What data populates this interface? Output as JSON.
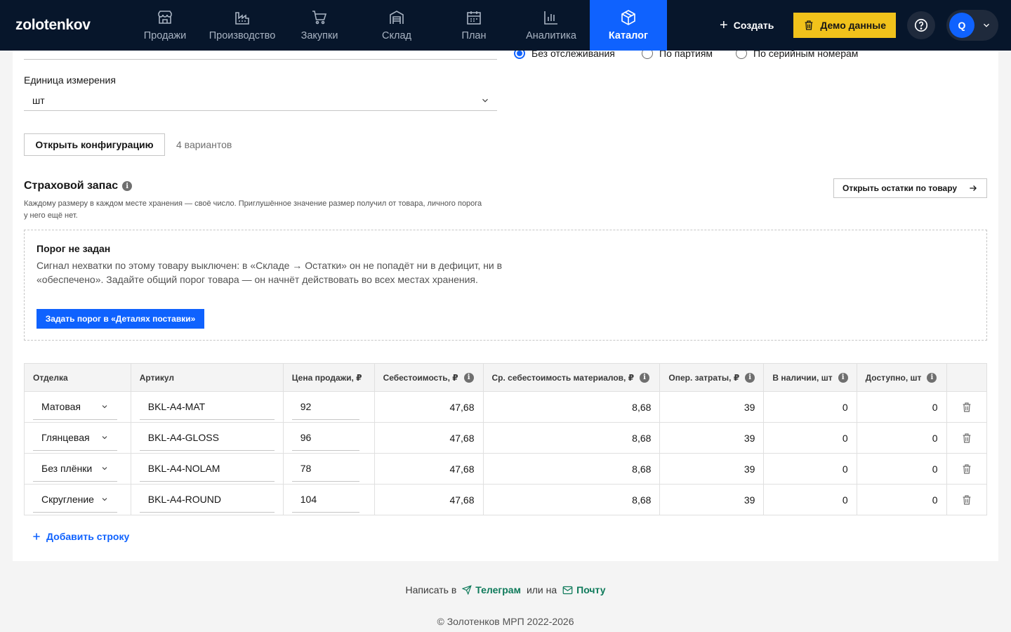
{
  "nav": {
    "logo": "zolotenkov",
    "items": [
      {
        "label": "Продажи",
        "icon": "store-icon"
      },
      {
        "label": "Производство",
        "icon": "factory-icon"
      },
      {
        "label": "Закупки",
        "icon": "cart-icon"
      },
      {
        "label": "Склад",
        "icon": "warehouse-icon"
      },
      {
        "label": "План",
        "icon": "calendar-icon"
      },
      {
        "label": "Аналитика",
        "icon": "bar-chart-icon"
      },
      {
        "label": "Каталог",
        "icon": "package-icon",
        "active": true
      }
    ],
    "create_label": "Создать",
    "demo_label": "Демо данные",
    "user_initial": "Q"
  },
  "form": {
    "unit_label": "Единица измерения",
    "unit_value": "шт",
    "tracking_options": [
      {
        "label": "Без отслеживания",
        "selected": true
      },
      {
        "label": "По партиям",
        "selected": false
      },
      {
        "label": "По серийным номерам",
        "selected": false
      }
    ],
    "open_config_label": "Открыть конфигурацию",
    "variants_count": "4 вариантов"
  },
  "safety_stock": {
    "title": "Страховой запас",
    "description": "Каждому размеру в каждом месте хранения — своё число. Приглушённое значение размер получил от товара, личного порога у него ещё нет.",
    "open_stock_label": "Открыть остатки по товару",
    "threshold_title": "Порог не задан",
    "threshold_text": "Сигнал нехватки по этому товару выключен: в «Складе → Остатки» он не попадёт ни в дефицит, ни в «обеспечено». Задайте общий порог товара — он начнёт действовать во всех местах хранения.",
    "threshold_button": "Задать порог в «Деталях поставки»"
  },
  "table": {
    "headers": {
      "finish": "Отделка",
      "sku": "Артикул",
      "price": "Цена продажи, ₽",
      "cost": "Себестоимость, ₽",
      "material_cost": "Ср. себестоимость материалов, ₽",
      "op_cost": "Опер. затраты, ₽",
      "in_stock": "В наличии, шт",
      "available": "Доступно, шт"
    },
    "rows": [
      {
        "finish": "Матовая",
        "sku": "BKL-A4-MAT",
        "price": "92",
        "cost": "47,68",
        "material_cost": "8,68",
        "op_cost": "39",
        "in_stock": "0",
        "available": "0"
      },
      {
        "finish": "Глянцевая",
        "sku": "BKL-A4-GLOSS",
        "price": "96",
        "cost": "47,68",
        "material_cost": "8,68",
        "op_cost": "39",
        "in_stock": "0",
        "available": "0"
      },
      {
        "finish": "Без плёнки",
        "sku": "BKL-A4-NOLAM",
        "price": "78",
        "cost": "47,68",
        "material_cost": "8,68",
        "op_cost": "39",
        "in_stock": "0",
        "available": "0"
      },
      {
        "finish": "Скругление",
        "sku": "BKL-A4-ROUND",
        "price": "104",
        "cost": "47,68",
        "material_cost": "8,68",
        "op_cost": "39",
        "in_stock": "0",
        "available": "0"
      }
    ],
    "add_row_label": "Добавить строку"
  },
  "footer": {
    "write_prefix": "Написать в",
    "telegram": "Телеграм",
    "or": "или на",
    "mail": "Почту",
    "copyright": "© Золотенков МРП 2022-2026"
  },
  "colors": {
    "nav_bg": "#07162b",
    "accent": "#0f62fe",
    "demo": "#f1c21b",
    "footer_link": "#0e7a5a"
  }
}
